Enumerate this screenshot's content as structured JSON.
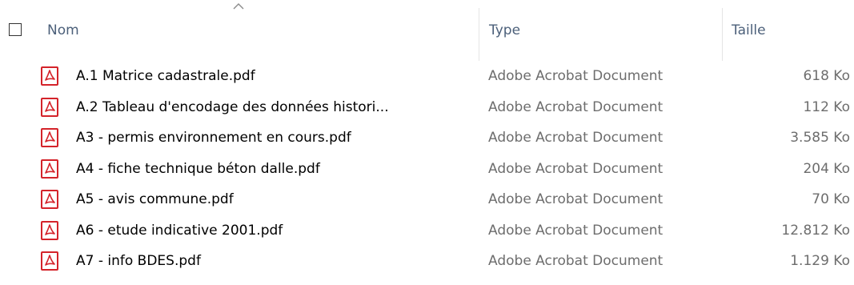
{
  "header": {
    "columns": {
      "name": "Nom",
      "type": "Type",
      "size": "Taille"
    },
    "sort_indicator_icon": "chevron-up-icon"
  },
  "files": [
    {
      "name": "A.1 Matrice cadastrale.pdf",
      "type": "Adobe Acrobat Document",
      "size": "618 Ko",
      "icon": "pdf-icon"
    },
    {
      "name": "A.2 Tableau d'encodage des données histori...",
      "type": "Adobe Acrobat Document",
      "size": "112 Ko",
      "icon": "pdf-icon"
    },
    {
      "name": "A3 - permis environnement en cours.pdf",
      "type": "Adobe Acrobat Document",
      "size": "3.585 Ko",
      "icon": "pdf-icon"
    },
    {
      "name": "A4 - fiche technique béton dalle.pdf",
      "type": "Adobe Acrobat Document",
      "size": "204 Ko",
      "icon": "pdf-icon"
    },
    {
      "name": "A5 - avis commune.pdf",
      "type": "Adobe Acrobat Document",
      "size": "70 Ko",
      "icon": "pdf-icon"
    },
    {
      "name": "A6 - etude indicative 2001.pdf",
      "type": "Adobe Acrobat Document",
      "size": "12.812 Ko",
      "icon": "pdf-icon"
    },
    {
      "name": "A7 - info BDES.pdf",
      "type": "Adobe Acrobat Document",
      "size": "1.129 Ko",
      "icon": "pdf-icon"
    }
  ],
  "colors": {
    "header_text": "#4c607a",
    "secondary_text": "#6d6d6d",
    "pdf_red": "#d4232a"
  }
}
